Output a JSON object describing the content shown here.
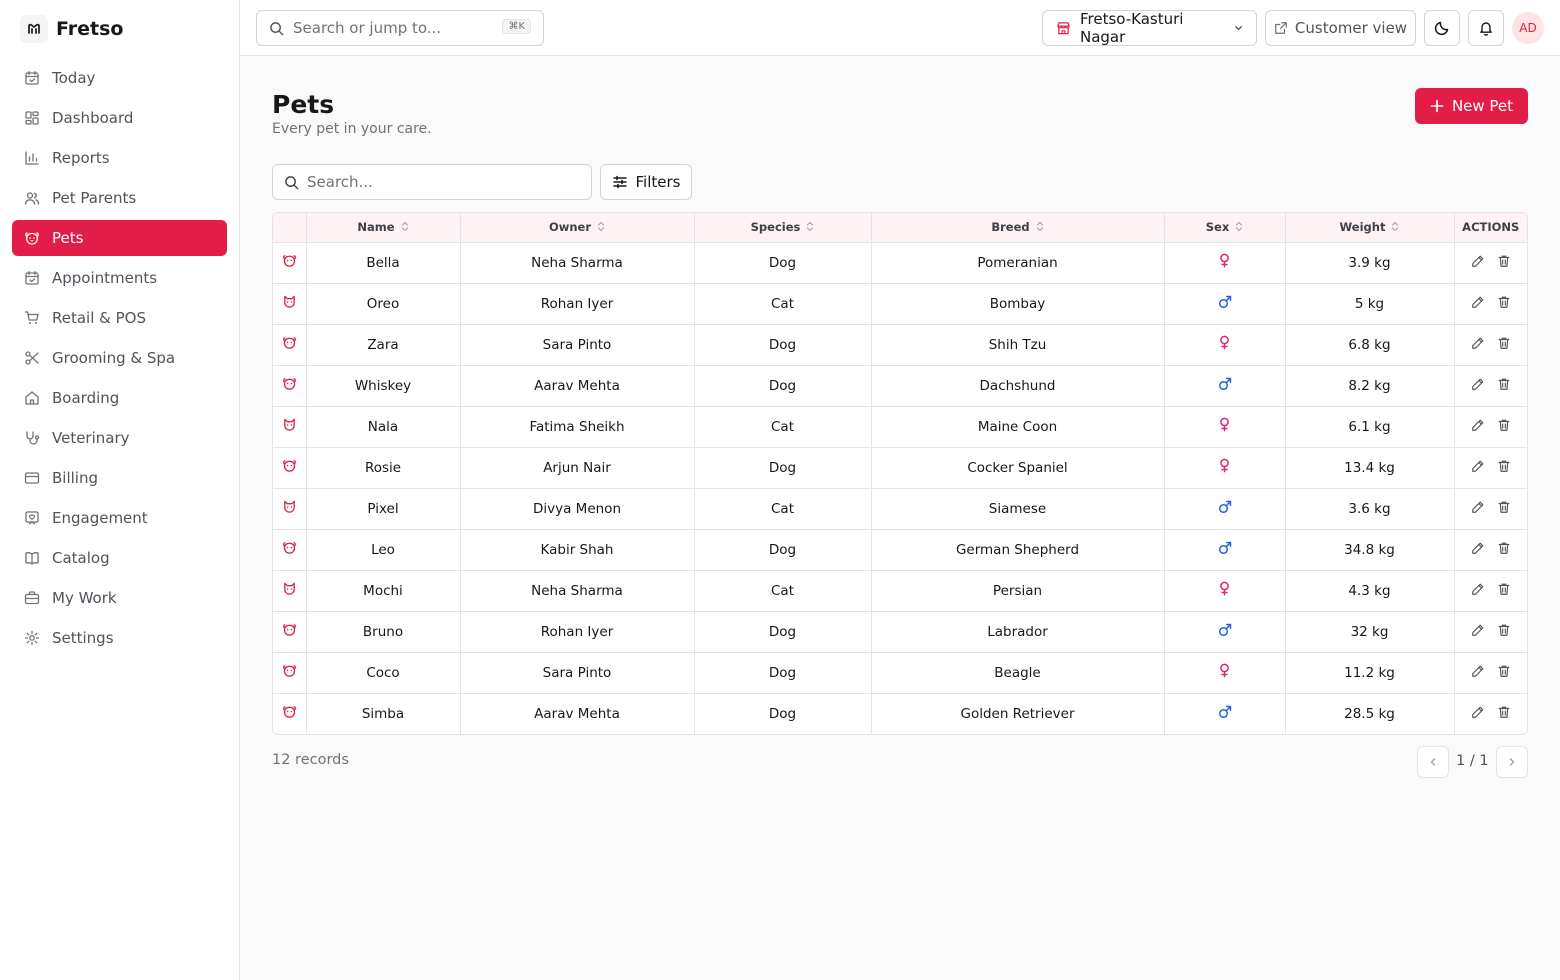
{
  "brand": {
    "name": "Fretso"
  },
  "sidebar": {
    "items": [
      {
        "label": "Today",
        "icon": "calendar-icon",
        "active": false
      },
      {
        "label": "Dashboard",
        "icon": "dashboard-icon",
        "active": false
      },
      {
        "label": "Reports",
        "icon": "bar-chart-icon",
        "active": false
      },
      {
        "label": "Pet Parents",
        "icon": "users-icon",
        "active": false
      },
      {
        "label": "Pets",
        "icon": "paw-icon",
        "active": true
      },
      {
        "label": "Appointments",
        "icon": "calendar-icon",
        "active": false
      },
      {
        "label": "Retail & POS",
        "icon": "cart-icon",
        "active": false
      },
      {
        "label": "Grooming & Spa",
        "icon": "scissors-icon",
        "active": false
      },
      {
        "label": "Boarding",
        "icon": "home-icon",
        "active": false
      },
      {
        "label": "Veterinary",
        "icon": "stethoscope-icon",
        "active": false
      },
      {
        "label": "Billing",
        "icon": "credit-card-icon",
        "active": false
      },
      {
        "label": "Engagement",
        "icon": "heart-message-icon",
        "active": false
      },
      {
        "label": "Catalog",
        "icon": "book-icon",
        "active": false
      },
      {
        "label": "My Work",
        "icon": "briefcase-icon",
        "active": false
      },
      {
        "label": "Settings",
        "icon": "gear-icon",
        "active": false
      }
    ]
  },
  "topbar": {
    "search_placeholder": "Search or jump to...",
    "search_shortcut": "⌘K",
    "store": "Fretso-Kasturi Nagar",
    "customer_view": "Customer view",
    "avatar_initials": "AD"
  },
  "page": {
    "title": "Pets",
    "subtitle": "Every pet in your care.",
    "new_button": "New Pet",
    "search_placeholder": "Search...",
    "filters_label": "Filters"
  },
  "table": {
    "columns": [
      "Name",
      "Owner",
      "Species",
      "Breed",
      "Sex",
      "Weight",
      "ACTIONS"
    ],
    "rows": [
      {
        "name": "Bella",
        "owner": "Neha Sharma",
        "species": "Dog",
        "breed": "Pomeranian",
        "sex": "female",
        "weight": "3.9 kg"
      },
      {
        "name": "Oreo",
        "owner": "Rohan Iyer",
        "species": "Cat",
        "breed": "Bombay",
        "sex": "male",
        "weight": "5 kg"
      },
      {
        "name": "Zara",
        "owner": "Sara Pinto",
        "species": "Dog",
        "breed": "Shih Tzu",
        "sex": "female",
        "weight": "6.8 kg"
      },
      {
        "name": "Whiskey",
        "owner": "Aarav Mehta",
        "species": "Dog",
        "breed": "Dachshund",
        "sex": "male",
        "weight": "8.2 kg"
      },
      {
        "name": "Nala",
        "owner": "Fatima Sheikh",
        "species": "Cat",
        "breed": "Maine Coon",
        "sex": "female",
        "weight": "6.1 kg"
      },
      {
        "name": "Rosie",
        "owner": "Arjun Nair",
        "species": "Dog",
        "breed": "Cocker Spaniel",
        "sex": "female",
        "weight": "13.4 kg"
      },
      {
        "name": "Pixel",
        "owner": "Divya Menon",
        "species": "Cat",
        "breed": "Siamese",
        "sex": "male",
        "weight": "3.6 kg"
      },
      {
        "name": "Leo",
        "owner": "Kabir Shah",
        "species": "Dog",
        "breed": "German Shepherd",
        "sex": "male",
        "weight": "34.8 kg"
      },
      {
        "name": "Mochi",
        "owner": "Neha Sharma",
        "species": "Cat",
        "breed": "Persian",
        "sex": "female",
        "weight": "4.3 kg"
      },
      {
        "name": "Bruno",
        "owner": "Rohan Iyer",
        "species": "Dog",
        "breed": "Labrador",
        "sex": "male",
        "weight": "32 kg"
      },
      {
        "name": "Coco",
        "owner": "Sara Pinto",
        "species": "Dog",
        "breed": "Beagle",
        "sex": "female",
        "weight": "11.2 kg"
      },
      {
        "name": "Simba",
        "owner": "Aarav Mehta",
        "species": "Dog",
        "breed": "Golden Retriever",
        "sex": "male",
        "weight": "28.5 kg"
      }
    ]
  },
  "footer": {
    "records": "12 records",
    "page": "1 / 1"
  },
  "colors": {
    "accent": "#e11d48",
    "female": "#db2777",
    "male": "#2563eb",
    "header_bg": "#fdf2f4"
  }
}
